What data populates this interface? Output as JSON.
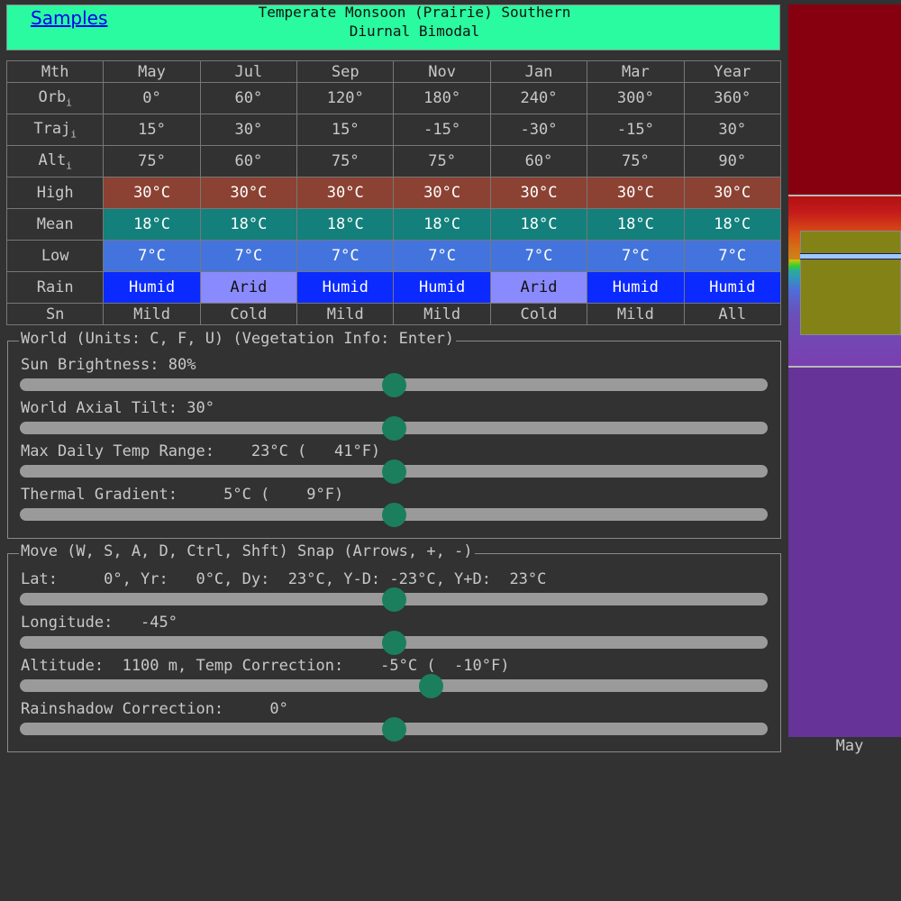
{
  "header": {
    "samples_link": "Samples",
    "title_line1": "Temperate Monsoon (Prairie) Southern",
    "title_line2": "Diurnal Bimodal"
  },
  "table": {
    "columns": [
      "Mth",
      "May",
      "Jul",
      "Sep",
      "Nov",
      "Jan",
      "Mar",
      "Year"
    ],
    "rows": {
      "orb": {
        "label": "Orb",
        "sub": "i",
        "values": [
          "0°",
          "60°",
          "120°",
          "180°",
          "240°",
          "300°",
          "360°"
        ]
      },
      "traj": {
        "label": "Traj",
        "sub": "i",
        "values": [
          "15°",
          "30°",
          "15°",
          "-15°",
          "-30°",
          "-15°",
          "30°"
        ]
      },
      "alt": {
        "label": "Alt",
        "sub": "i",
        "values": [
          "75°",
          "60°",
          "75°",
          "75°",
          "60°",
          "75°",
          "90°"
        ]
      },
      "high": {
        "label": "High",
        "values": [
          "30°C",
          "30°C",
          "30°C",
          "30°C",
          "30°C",
          "30°C",
          "30°C"
        ]
      },
      "mean": {
        "label": "Mean",
        "values": [
          "18°C",
          "18°C",
          "18°C",
          "18°C",
          "18°C",
          "18°C",
          "18°C"
        ]
      },
      "low": {
        "label": "Low",
        "values": [
          "7°C",
          "7°C",
          "7°C",
          "7°C",
          "7°C",
          "7°C",
          "7°C"
        ]
      },
      "rain": {
        "label": "Rain",
        "values": [
          "Humid",
          "Arid",
          "Humid",
          "Humid",
          "Arid",
          "Humid",
          "Humid"
        ]
      },
      "sn": {
        "label": "Sn",
        "values": [
          "Mild",
          "Cold",
          "Mild",
          "Mild",
          "Cold",
          "Mild",
          "All"
        ]
      }
    }
  },
  "world": {
    "legend": "World (Units: C, F, U) (Vegetation Info: Enter)",
    "sun_label": "Sun Brightness: 80%",
    "tilt_label": "World Axial Tilt: 30°",
    "range_label": "Max Daily Temp Range:    23°C (   41°F)",
    "gradient_label": "Thermal Gradient:     5°C (    9°F)",
    "sun_value": 0.5,
    "tilt_value": 0.5,
    "range_value": 0.5,
    "gradient_value": 0.5
  },
  "move": {
    "legend": "Move (W, S, A, D, Ctrl, Shft) Snap (Arrows, +, -)",
    "lat_label": "Lat:     0°, Yr:   0°C, Dy:  23°C, Y-D: -23°C, Y+D:  23°C",
    "lon_label": "Longitude:   -45°",
    "alt_label": "Altitude:  1100 m, Temp Correction:    -5°C (  -10°F)",
    "rain_label": "Rainshadow Correction:     0°",
    "lat_value": 0.5,
    "lon_value": 0.5,
    "alt_value": 0.55,
    "rain_value": 0.5
  },
  "side_panel": {
    "month_label": "May"
  },
  "colors": {
    "header_bg": "#2afaa0",
    "high": "#8b4233",
    "mean": "#13807c",
    "low": "#4374dd",
    "humid": "#0b2aff",
    "arid": "#8a8aff",
    "slider_thumb": "#1b7f5e"
  }
}
